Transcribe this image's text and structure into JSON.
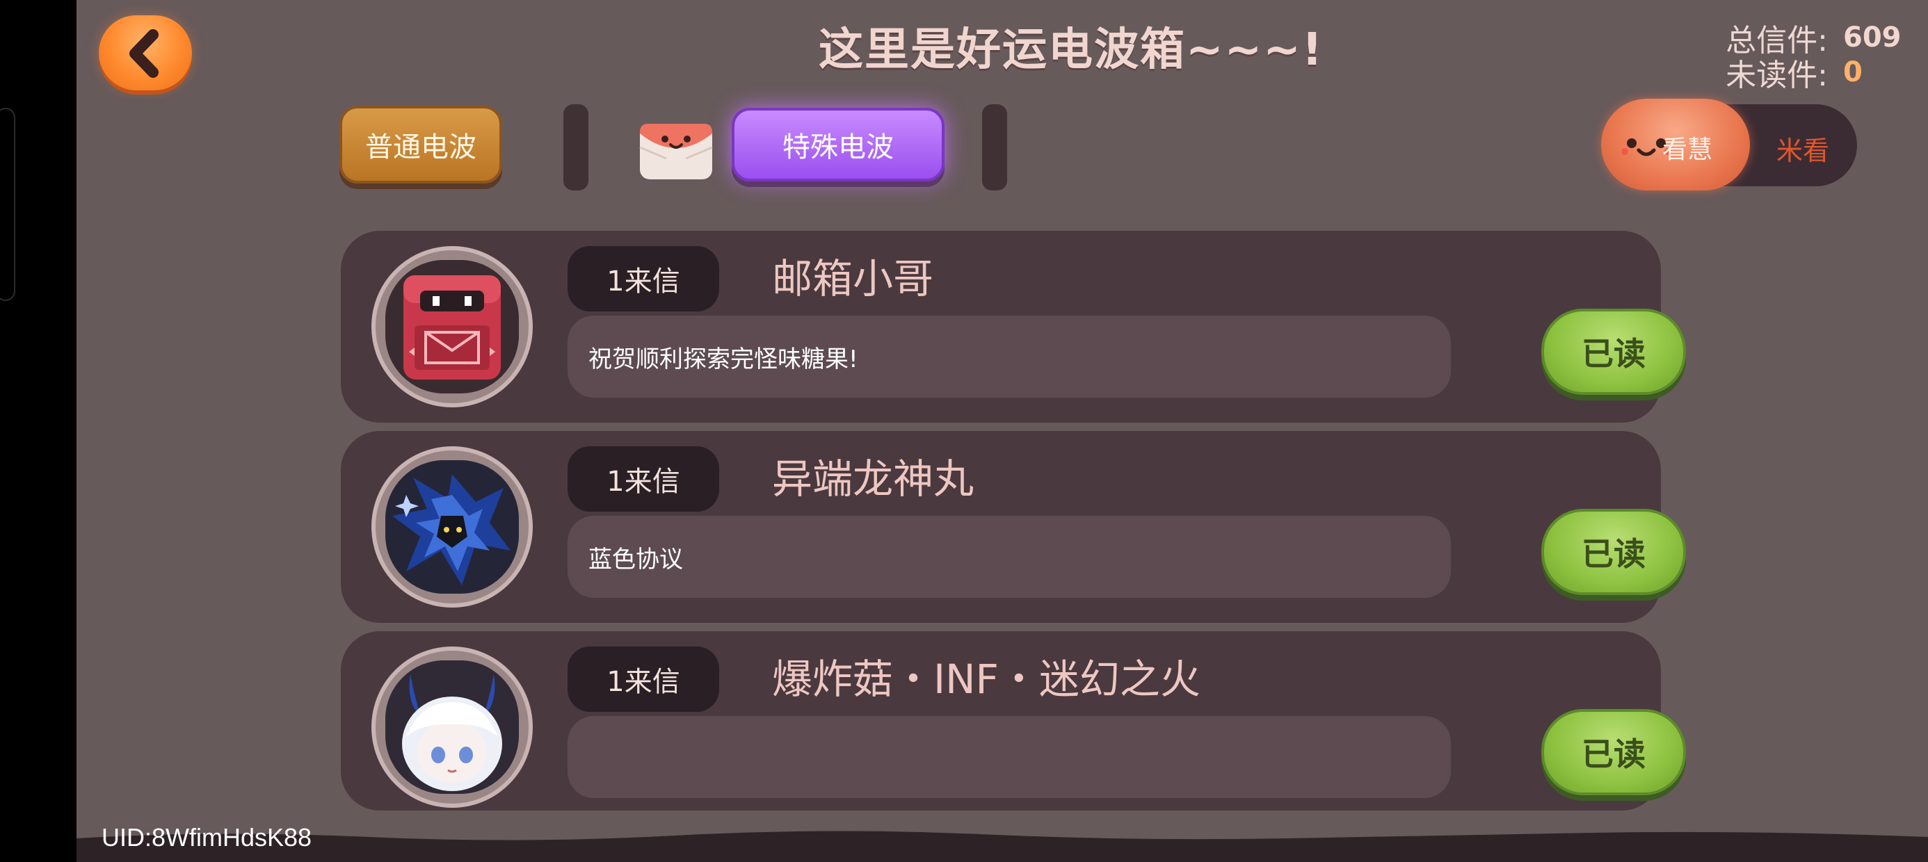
{
  "header": {
    "back_icon": "back-arrow-icon",
    "title": "这里是好运电波箱~~~!",
    "total_label": "总信件:",
    "total_value": "609",
    "unread_label": "未读件:",
    "unread_value": "0"
  },
  "tabs": {
    "normal_label": "普通电波",
    "special_label": "特殊电波",
    "active": "special",
    "envelope_icon": "envelope-face-icon"
  },
  "view_toggle": {
    "on_label": "看慧",
    "off_label": "米看"
  },
  "mails": [
    {
      "badge": "1来信",
      "sender": "邮箱小哥",
      "message": "祝贺顺利探索完怪味糖果!",
      "status": "已读",
      "avatar_icon": "mailbox-robot-icon"
    },
    {
      "badge": "1来信",
      "sender": "异端龙神丸",
      "message": "蓝色协议",
      "status": "已读",
      "avatar_icon": "blue-dragon-icon"
    },
    {
      "badge": "1来信",
      "sender": "爆炸菇・INF・迷幻之火",
      "message": "",
      "status": "已读",
      "avatar_icon": "white-hair-girl-icon"
    }
  ],
  "footer": {
    "uid": "UID:8WfimHdsK88"
  },
  "colors": {
    "background": "#675a5b",
    "card": "#4a3a3f",
    "accent_orange": "#ff8a2e",
    "accent_purple": "#9a4fef",
    "read_green": "#8ec240"
  }
}
